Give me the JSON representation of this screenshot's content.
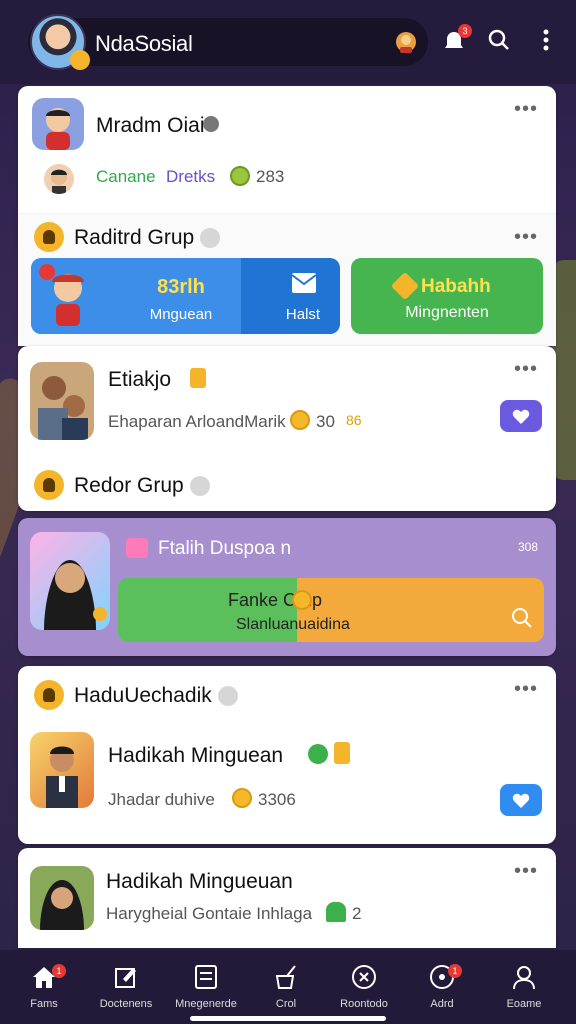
{
  "header": {
    "app_title": "NdaSosial",
    "notif_count": "3"
  },
  "profile_card": {
    "name": "Mradm Oiai",
    "stats_a": "Canane",
    "stats_b": "Dretks",
    "stats_count": "283"
  },
  "group_card": {
    "title": "Raditrd Grup",
    "actions": [
      {
        "title": "83rlh",
        "label": "Mnguean"
      },
      {
        "title": "",
        "label": "Halst"
      },
      {
        "title": "Habahh",
        "label": "Mingnenten"
      }
    ]
  },
  "post1": {
    "name": "Etiakjo",
    "sub_text": "Ehaparan ArloandMarik",
    "count": "30",
    "extra": "86"
  },
  "group2": {
    "title": "Redor Grup"
  },
  "promo": {
    "title": "Ftalih Duspoa n",
    "time": "308",
    "bar_title": "Fanke Crup",
    "bar_sub": "Slanluanuaidina"
  },
  "group3": {
    "title": "HaduUechadik"
  },
  "post2": {
    "name": "Hadikah Minguean",
    "sub_text": "Jhadar duhive",
    "count": "3306"
  },
  "post3": {
    "name": "Hadikah Mingueuan",
    "sub_text": "Harygheial Gontaie Inhlaga",
    "count": "2"
  },
  "nav": [
    {
      "label": "Fams",
      "badge": "1"
    },
    {
      "label": "Doctenens"
    },
    {
      "label": "Mnegenerde"
    },
    {
      "label": "Crol"
    },
    {
      "label": "Roontodo"
    },
    {
      "label": "Adrd",
      "badge": "1"
    },
    {
      "label": "Eoame"
    }
  ]
}
